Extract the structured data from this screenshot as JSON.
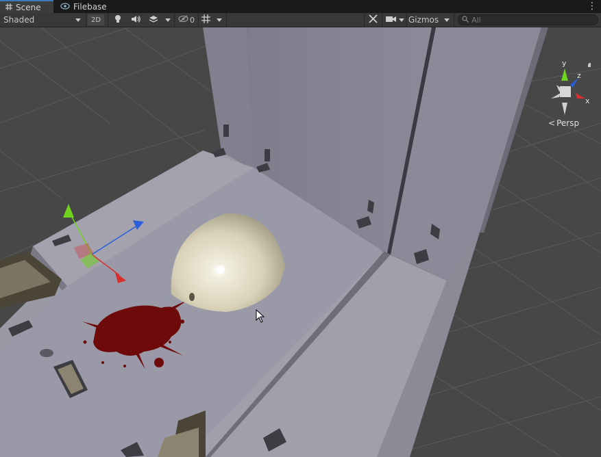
{
  "tabs": [
    {
      "label": "Scene",
      "icon": "grid-icon",
      "active": true
    },
    {
      "label": "Filebase",
      "icon": "eye-icon",
      "active": false
    }
  ],
  "toolbar": {
    "shading_mode": "Shaded",
    "mode_2d": "2D",
    "hidden_count": "0",
    "gizmos_label": "Gizmos",
    "search_placeholder": "All"
  },
  "scene_gizmo": {
    "axis_y": "y",
    "axis_z": "z",
    "axis_x": "x",
    "projection": "Persp"
  },
  "colors": {
    "accent": "#3a79bb",
    "axis_x": "#d92f2f",
    "axis_y": "#6fd21d",
    "axis_z": "#2b5fd9",
    "background": "#464646",
    "floor_panel": "#9090a0",
    "blood": "#6e0a0a",
    "sphere": "#e8e2cc"
  }
}
